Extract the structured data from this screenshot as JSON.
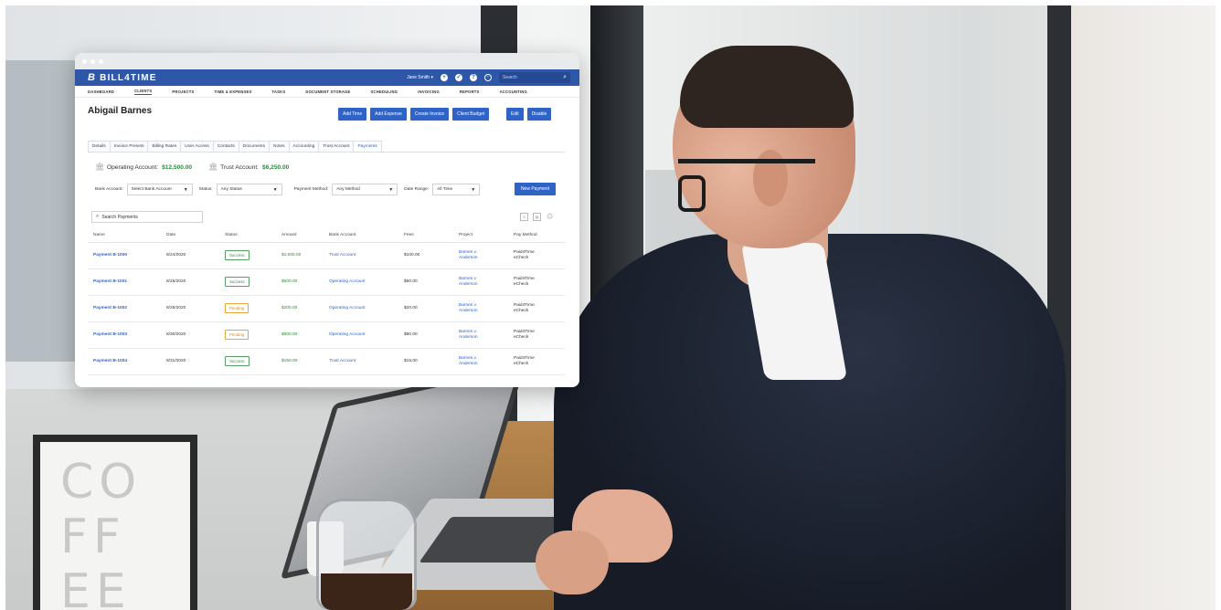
{
  "app": {
    "brand": "BILL4TIME",
    "brand_mark": "B",
    "user_menu": "Jane Smith ▾",
    "search_placeholder": "Search"
  },
  "nav": [
    "DASHBOARD",
    "CLIENTS",
    "PROJECTS",
    "TIME & EXPENSES",
    "TASKS",
    "DOCUMENT STORAGE",
    "SCHEDULING",
    "INVOICING",
    "REPORTS",
    "ACCOUNTING"
  ],
  "client": {
    "name": "Abigail Barnes"
  },
  "actions": [
    "Add Time",
    "Add Expense",
    "Create Invoice",
    "Client Budget"
  ],
  "actions2": [
    "Edit",
    "Disable"
  ],
  "tabs": [
    "Details",
    "Invoice Presets",
    "Billing Rates",
    "User Access",
    "Contacts",
    "Documents",
    "Notes",
    "Accounting",
    "Trust Account",
    "Payments"
  ],
  "accounts": {
    "operating_label": "Operating Account:",
    "operating_amount": "$12,500.00",
    "trust_label": "Trust Account:",
    "trust_amount": "$6,250.00"
  },
  "filters": {
    "bank_label": "Bank Account:",
    "bank_value": "Select Bank Account",
    "status_label": "Status:",
    "status_value": "Any Status",
    "method_label": "Payment Method:",
    "method_value": "Any Method",
    "range_label": "Date Range:",
    "range_value": "All Time",
    "new_payment": "New Payment"
  },
  "search": {
    "placeholder": "Search Payments"
  },
  "table": {
    "headers": [
      "Name",
      "Date",
      "Status",
      "Amount",
      "Bank Account",
      "Fees",
      "Project",
      "Pay Method"
    ],
    "rows": [
      {
        "name": "Payment B-1000",
        "date": "8/24/2020",
        "status": "Success",
        "amount": "$1,000.00",
        "bank": "Trust Account",
        "fees": "$100.00",
        "project1": "Barnes v.",
        "project2": "Anderson",
        "method1": "Paid4Time",
        "method2": "eCheck"
      },
      {
        "name": "Payment B-1001",
        "date": "8/25/2020",
        "status": "Success",
        "amount": "$500.00",
        "bank": "Operating Account",
        "fees": "$50.00",
        "project1": "Barnes v.",
        "project2": "Anderson",
        "method1": "Paid4Time",
        "method2": "eCheck"
      },
      {
        "name": "Payment B-1002",
        "date": "8/29/2020",
        "status": "Pending",
        "amount": "$200.00",
        "bank": "Operating Account",
        "fees": "$20.00",
        "project1": "Barnes v.",
        "project2": "Anderson",
        "method1": "Paid4Time",
        "method2": "eCheck"
      },
      {
        "name": "Payment B-1003",
        "date": "8/30/2020",
        "status": "Pending",
        "amount": "$800.00",
        "bank": "Operating Account",
        "fees": "$80.00",
        "project1": "Barnes v.",
        "project2": "Anderson",
        "method1": "Paid4Time",
        "method2": "eCheck"
      },
      {
        "name": "Payment B-1004",
        "date": "8/31/2020",
        "status": "Success",
        "amount": "$150.00",
        "bank": "Trust Account",
        "fees": "$15.00",
        "project1": "Barnes v.",
        "project2": "Anderson",
        "method1": "Paid4Time",
        "method2": "eCheck"
      }
    ]
  },
  "photo": {
    "sign_text": "CO\nFF\nEE"
  },
  "colors": {
    "brand": "#2f57a8",
    "button": "#2f63c6",
    "success": "#2f8a3c",
    "pending": "#e8a43c"
  }
}
